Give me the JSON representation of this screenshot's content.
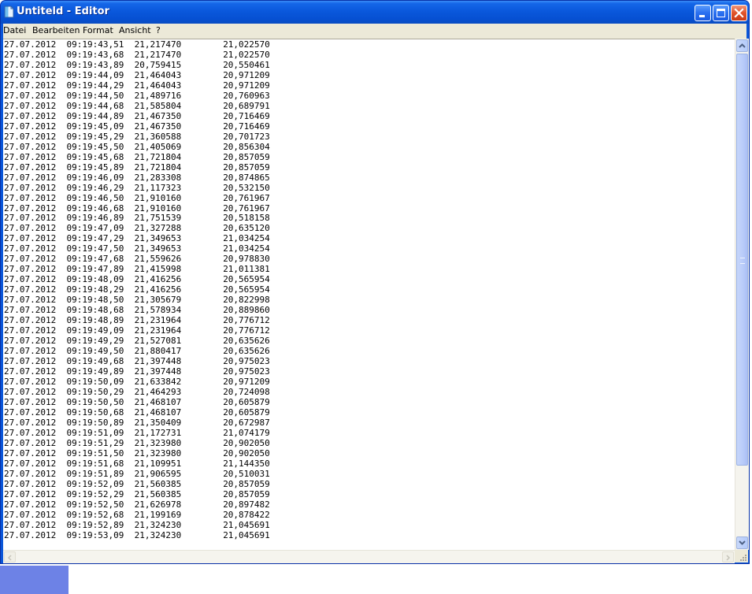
{
  "window": {
    "title": "Untiteld - Editor",
    "title_color": "#ffffff",
    "titlebar_color": "#0a58dc"
  },
  "menu": [
    {
      "label": "Datei"
    },
    {
      "label": "Bearbeiten"
    },
    {
      "label": "Format"
    },
    {
      "label": "Ansicht"
    },
    {
      "label": "?"
    }
  ],
  "icons": {
    "app": "notepad-icon",
    "minimize": "minimize-icon",
    "maximize": "maximize-icon",
    "close": "close-icon",
    "scroll_up": "arrow-up-icon",
    "scroll_down": "arrow-down-icon",
    "scroll_left": "arrow-left-icon",
    "scroll_right": "arrow-right-icon"
  },
  "rows": [
    [
      "27.07.2012",
      "09:19:43,51",
      "21,217470",
      "21,022570"
    ],
    [
      "27.07.2012",
      "09:19:43,68",
      "21,217470",
      "21,022570"
    ],
    [
      "27.07.2012",
      "09:19:43,89",
      "20,759415",
      "20,550461"
    ],
    [
      "27.07.2012",
      "09:19:44,09",
      "21,464043",
      "20,971209"
    ],
    [
      "27.07.2012",
      "09:19:44,29",
      "21,464043",
      "20,971209"
    ],
    [
      "27.07.2012",
      "09:19:44,50",
      "21,489716",
      "20,760963"
    ],
    [
      "27.07.2012",
      "09:19:44,68",
      "21,585804",
      "20,689791"
    ],
    [
      "27.07.2012",
      "09:19:44,89",
      "21,467350",
      "20,716469"
    ],
    [
      "27.07.2012",
      "09:19:45,09",
      "21,467350",
      "20,716469"
    ],
    [
      "27.07.2012",
      "09:19:45,29",
      "21,360588",
      "20,701723"
    ],
    [
      "27.07.2012",
      "09:19:45,50",
      "21,405069",
      "20,856304"
    ],
    [
      "27.07.2012",
      "09:19:45,68",
      "21,721804",
      "20,857059"
    ],
    [
      "27.07.2012",
      "09:19:45,89",
      "21,721804",
      "20,857059"
    ],
    [
      "27.07.2012",
      "09:19:46,09",
      "21,283308",
      "20,874865"
    ],
    [
      "27.07.2012",
      "09:19:46,29",
      "21,117323",
      "20,532150"
    ],
    [
      "27.07.2012",
      "09:19:46,50",
      "21,910160",
      "20,761967"
    ],
    [
      "27.07.2012",
      "09:19:46,68",
      "21,910160",
      "20,761967"
    ],
    [
      "27.07.2012",
      "09:19:46,89",
      "21,751539",
      "20,518158"
    ],
    [
      "27.07.2012",
      "09:19:47,09",
      "21,327288",
      "20,635120"
    ],
    [
      "27.07.2012",
      "09:19:47,29",
      "21,349653",
      "21,034254"
    ],
    [
      "27.07.2012",
      "09:19:47,50",
      "21,349653",
      "21,034254"
    ],
    [
      "27.07.2012",
      "09:19:47,68",
      "21,559626",
      "20,978830"
    ],
    [
      "27.07.2012",
      "09:19:47,89",
      "21,415998",
      "21,011381"
    ],
    [
      "27.07.2012",
      "09:19:48,09",
      "21,416256",
      "20,565954"
    ],
    [
      "27.07.2012",
      "09:19:48,29",
      "21,416256",
      "20,565954"
    ],
    [
      "27.07.2012",
      "09:19:48,50",
      "21,305679",
      "20,822998"
    ],
    [
      "27.07.2012",
      "09:19:48,68",
      "21,578934",
      "20,889860"
    ],
    [
      "27.07.2012",
      "09:19:48,89",
      "21,231964",
      "20,776712"
    ],
    [
      "27.07.2012",
      "09:19:49,09",
      "21,231964",
      "20,776712"
    ],
    [
      "27.07.2012",
      "09:19:49,29",
      "21,527081",
      "20,635626"
    ],
    [
      "27.07.2012",
      "09:19:49,50",
      "21,880417",
      "20,635626"
    ],
    [
      "27.07.2012",
      "09:19:49,68",
      "21,397448",
      "20,975023"
    ],
    [
      "27.07.2012",
      "09:19:49,89",
      "21,397448",
      "20,975023"
    ],
    [
      "27.07.2012",
      "09:19:50,09",
      "21,633842",
      "20,971209"
    ],
    [
      "27.07.2012",
      "09:19:50,29",
      "21,464293",
      "20,724098"
    ],
    [
      "27.07.2012",
      "09:19:50,50",
      "21,468107",
      "20,605879"
    ],
    [
      "27.07.2012",
      "09:19:50,68",
      "21,468107",
      "20,605879"
    ],
    [
      "27.07.2012",
      "09:19:50,89",
      "21,350409",
      "20,672987"
    ],
    [
      "27.07.2012",
      "09:19:51,09",
      "21,172731",
      "21,074179"
    ],
    [
      "27.07.2012",
      "09:19:51,29",
      "21,323980",
      "20,902050"
    ],
    [
      "27.07.2012",
      "09:19:51,50",
      "21,323980",
      "20,902050"
    ],
    [
      "27.07.2012",
      "09:19:51,68",
      "21,109951",
      "21,144350"
    ],
    [
      "27.07.2012",
      "09:19:51,89",
      "21,906595",
      "20,510031"
    ],
    [
      "27.07.2012",
      "09:19:52,09",
      "21,560385",
      "20,857059"
    ],
    [
      "27.07.2012",
      "09:19:52,29",
      "21,560385",
      "20,857059"
    ],
    [
      "27.07.2012",
      "09:19:52,50",
      "21,626978",
      "20,897482"
    ],
    [
      "27.07.2012",
      "09:19:52,68",
      "21,199169",
      "20,878422"
    ],
    [
      "27.07.2012",
      "09:19:52,89",
      "21,324230",
      "21,045691"
    ],
    [
      "27.07.2012",
      "09:19:53,09",
      "21,324230",
      "21,045691"
    ]
  ]
}
